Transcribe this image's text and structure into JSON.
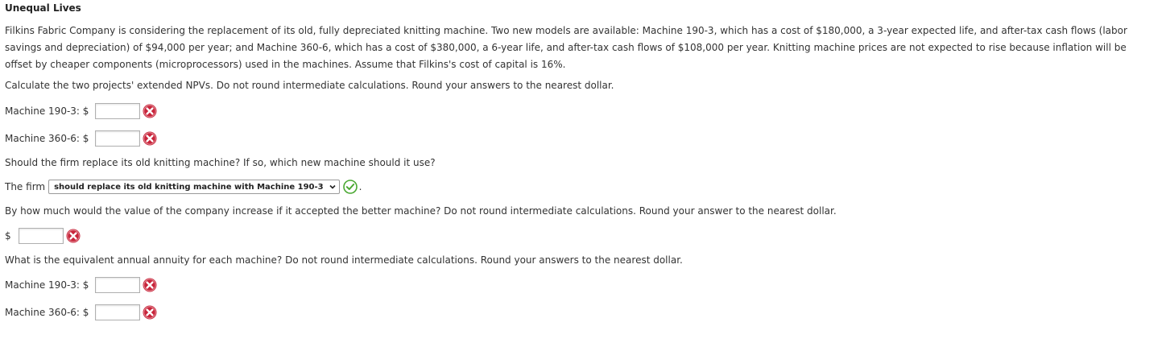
{
  "title": "Unequal Lives",
  "problem_text": "Filkins Fabric Company is considering the replacement of its old, fully depreciated knitting machine. Two new models are available: Machine 190-3, which has a cost of $180,000, a 3-year expected life, and after-tax cash flows (labor savings and depreciation) of $94,000 per year; and Machine 360-6, which has a cost of $380,000, a 6-year life, and after-tax cash flows of $108,000 per year. Knitting machine prices are not expected to rise because inflation will be offset by cheaper components (microprocessors) used in the machines. Assume that Filkins's cost of capital is 16%.",
  "q1": {
    "instruction": "Calculate the two projects' extended NPVs. Do not round intermediate calculations. Round your answers to the nearest dollar.",
    "machine_a_label": "Machine 190-3: $",
    "machine_a_value": "",
    "machine_b_label": "Machine 360-6: $",
    "machine_b_value": ""
  },
  "q2": {
    "question": "Should the firm replace its old knitting machine? If so, which new machine should it use?",
    "prefix": "The firm",
    "selected": "should replace its old knitting machine with Machine 190-3",
    "suffix": "."
  },
  "q3": {
    "question": "By how much would the value of the company increase if it accepted the better machine? Do not round intermediate calculations. Round your answer to the nearest dollar.",
    "currency": "$",
    "value": ""
  },
  "q4": {
    "question": "What is the equivalent annual annuity for each machine? Do not round intermediate calculations. Round your answers to the nearest dollar.",
    "machine_a_label": "Machine 190-3: $",
    "machine_a_value": "",
    "machine_b_label": "Machine 360-6: $",
    "machine_b_value": ""
  },
  "colors": {
    "incorrect": "#c8253b",
    "correct": "#4aa832"
  },
  "icons": {
    "incorrect": "incorrect-x-icon",
    "correct": "correct-check-icon",
    "dropdown": "chevron-down-icon"
  }
}
